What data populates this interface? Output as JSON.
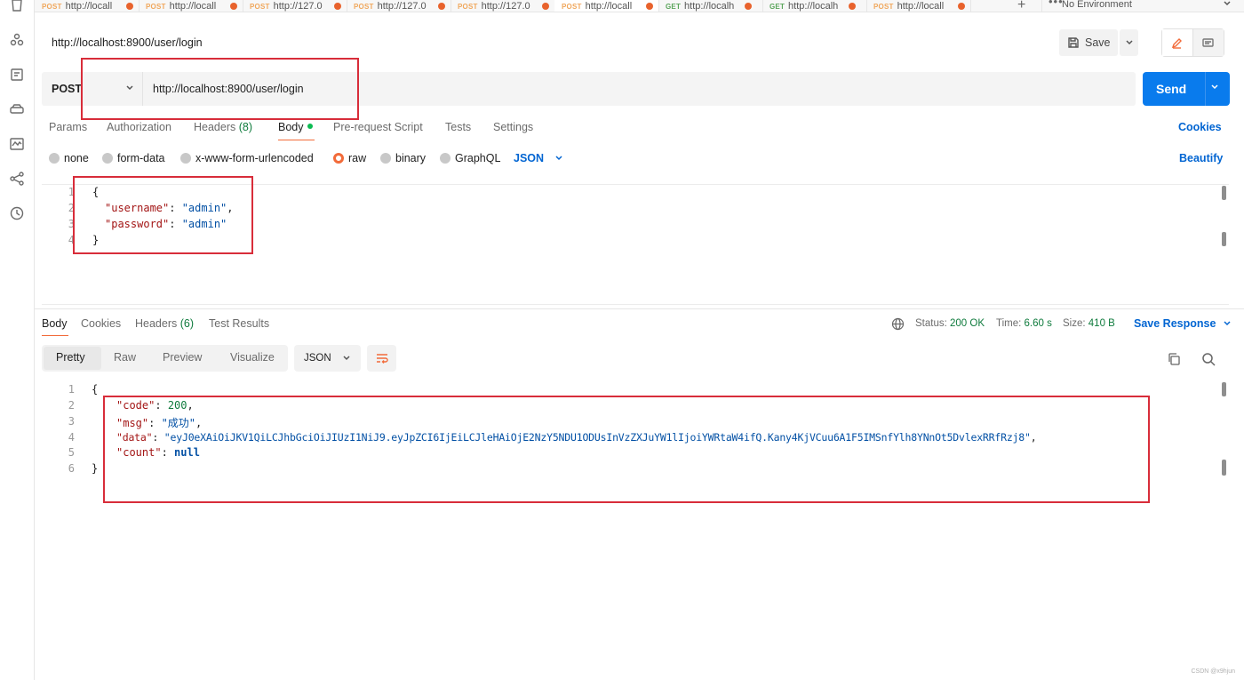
{
  "tabs": [
    {
      "method": "POST",
      "url": "http://locall"
    },
    {
      "method": "POST",
      "url": "http://locall"
    },
    {
      "method": "POST",
      "url": "http://127.0"
    },
    {
      "method": "POST",
      "url": "http://127.0"
    },
    {
      "method": "POST",
      "url": "http://127.0"
    },
    {
      "method": "POST",
      "url": "http://locall"
    },
    {
      "method": "GET",
      "url": "http://localh"
    },
    {
      "method": "GET",
      "url": "http://localh"
    },
    {
      "method": "POST",
      "url": "http://locall"
    }
  ],
  "environment": "No Environment",
  "request": {
    "title": "http://localhost:8900/user/login",
    "method": "POST",
    "url": "http://localhost:8900/user/login",
    "save_label": "Save",
    "send_label": "Send"
  },
  "request_tabs": {
    "params": "Params",
    "authorization": "Authorization",
    "headers": "Headers",
    "headers_count": "(8)",
    "body": "Body",
    "pre_request": "Pre-request Script",
    "tests": "Tests",
    "settings": "Settings",
    "cookies": "Cookies"
  },
  "body_types": {
    "none": "none",
    "form_data": "form-data",
    "urlencoded": "x-www-form-urlencoded",
    "raw": "raw",
    "binary": "binary",
    "graphql": "GraphQL",
    "format": "JSON",
    "beautify": "Beautify"
  },
  "request_body": {
    "line_numbers": [
      "1",
      "2",
      "3",
      "4"
    ],
    "open_brace": "{",
    "close_brace": "}",
    "fields": [
      {
        "key": "\"username\"",
        "value": "\"admin\"",
        "trail": ","
      },
      {
        "key": "\"password\"",
        "value": "\"admin\"",
        "trail": ""
      }
    ]
  },
  "response_tabs": {
    "body": "Body",
    "cookies": "Cookies",
    "headers": "Headers",
    "headers_count": "(6)",
    "test_results": "Test Results"
  },
  "response_status": {
    "status_label": "Status:",
    "status_value": "200 OK",
    "time_label": "Time:",
    "time_value": "6.60 s",
    "size_label": "Size:",
    "size_value": "410 B",
    "save_response": "Save Response"
  },
  "view_modes": {
    "pretty": "Pretty",
    "raw": "Raw",
    "preview": "Preview",
    "visualize": "Visualize",
    "format": "JSON"
  },
  "response_body": {
    "line_numbers": [
      "1",
      "2",
      "3",
      "4",
      "5",
      "6"
    ],
    "open_brace": "{",
    "close_brace": "}",
    "code_key": "\"code\"",
    "code_value": "200",
    "msg_key": "\"msg\"",
    "msg_value": "\"成功\"",
    "data_key": "\"data\"",
    "data_value": "\"eyJ0eXAiOiJKV1QiLCJhbGciOiJIUzI1NiJ9.eyJpZCI6IjEiLCJleHAiOjE2NzY5NDU1ODUsInVzZXJuYW1lIjoiYWRtaW4ifQ.Kany4KjVCuu6A1F5IMSnfYlh8YNnOt5DvlexRRfRzj8\"",
    "count_key": "\"count\"",
    "count_value": "null"
  },
  "watermark": "CSDN @x9hjun",
  "colors": {
    "accent": "#097bed",
    "link": "#0265d2",
    "annotation": "#d82d3a",
    "orange": "#f26b3a",
    "status_ok": "#0f7b3d"
  }
}
